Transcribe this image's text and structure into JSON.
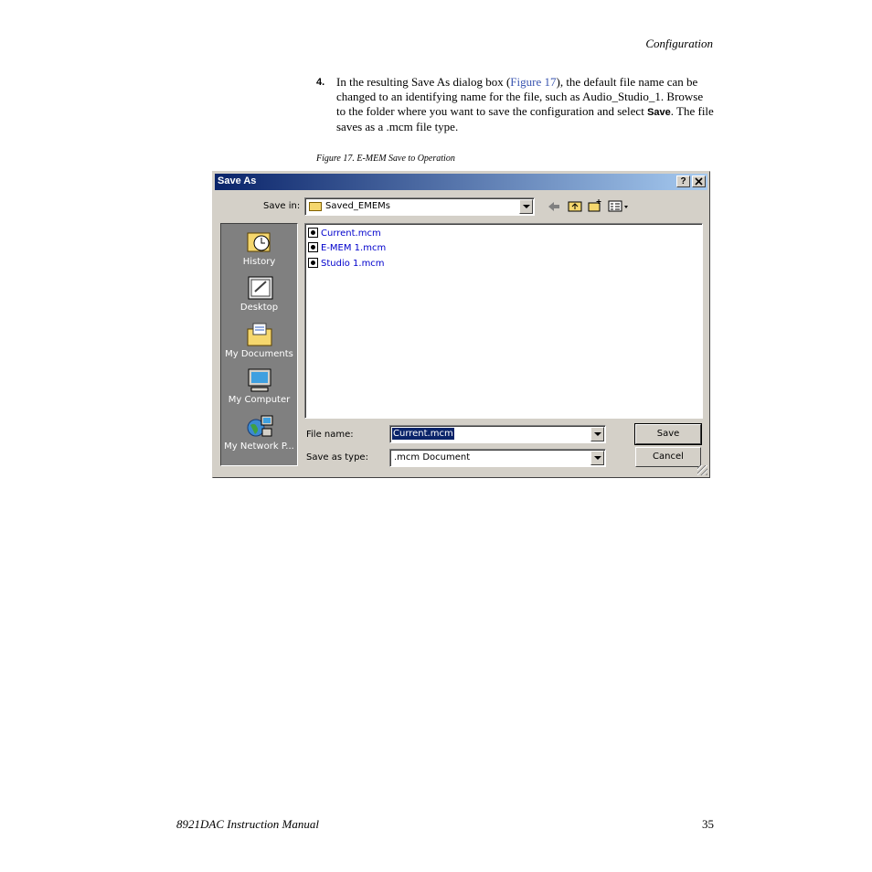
{
  "header": {
    "section": "Configuration"
  },
  "step": {
    "number": "4.",
    "text_before_link": "In the resulting Save As dialog box (",
    "link": "Figure 17",
    "text_after_link": "), the default file name can be changed to an identifying name for the file, such as Audio_Studio_1. Browse to the folder where you want to save the configuration and select ",
    "bold_word": "Save",
    "text_end": ". The file saves as a .mcm file type."
  },
  "caption": "Figure 17.  E-MEM Save to Operation",
  "dialog": {
    "title": "Save As",
    "help_button": "?",
    "close_button": "X",
    "save_in_label": "Save in:",
    "save_in_value": "Saved_EMEMs",
    "places": [
      {
        "label": "History",
        "icon": "history-icon"
      },
      {
        "label": "Desktop",
        "icon": "desktop-icon"
      },
      {
        "label": "My Documents",
        "icon": "my-documents-icon"
      },
      {
        "label": "My Computer",
        "icon": "my-computer-icon"
      },
      {
        "label": "My Network P...",
        "icon": "my-network-places-icon"
      }
    ],
    "files": [
      "Current.mcm",
      "E-MEM 1.mcm",
      "Studio 1.mcm"
    ],
    "file_name_label": "File name:",
    "file_name_value": "Current.mcm",
    "save_as_type_label": "Save as type:",
    "save_as_type_value": ".mcm Document",
    "save_button": "Save",
    "cancel_button": "Cancel"
  },
  "footer": {
    "manual": "8921DAC Instruction Manual",
    "page": "35"
  }
}
